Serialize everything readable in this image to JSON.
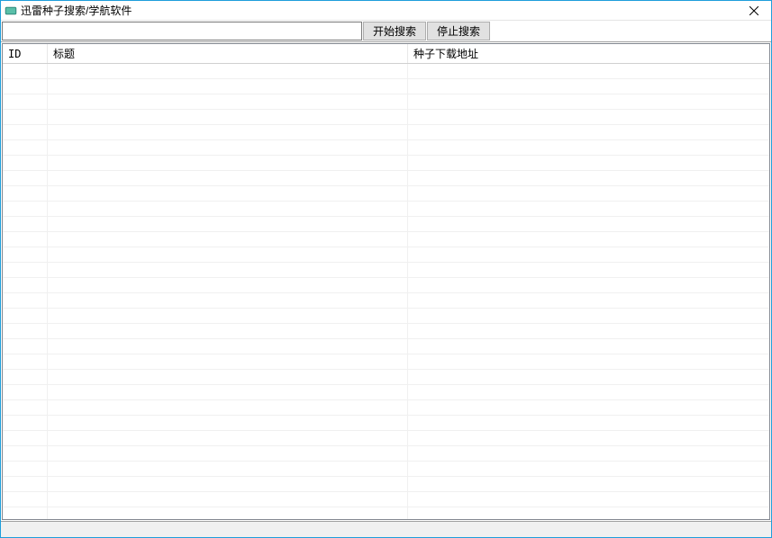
{
  "window": {
    "title": "迅雷种子搜索/学航软件"
  },
  "toolbar": {
    "search_value": "",
    "start_search_label": "开始搜索",
    "stop_search_label": "停止搜索"
  },
  "table": {
    "columns": {
      "id": "ID",
      "title": "标题",
      "download": "种子下载地址"
    },
    "rows": []
  }
}
